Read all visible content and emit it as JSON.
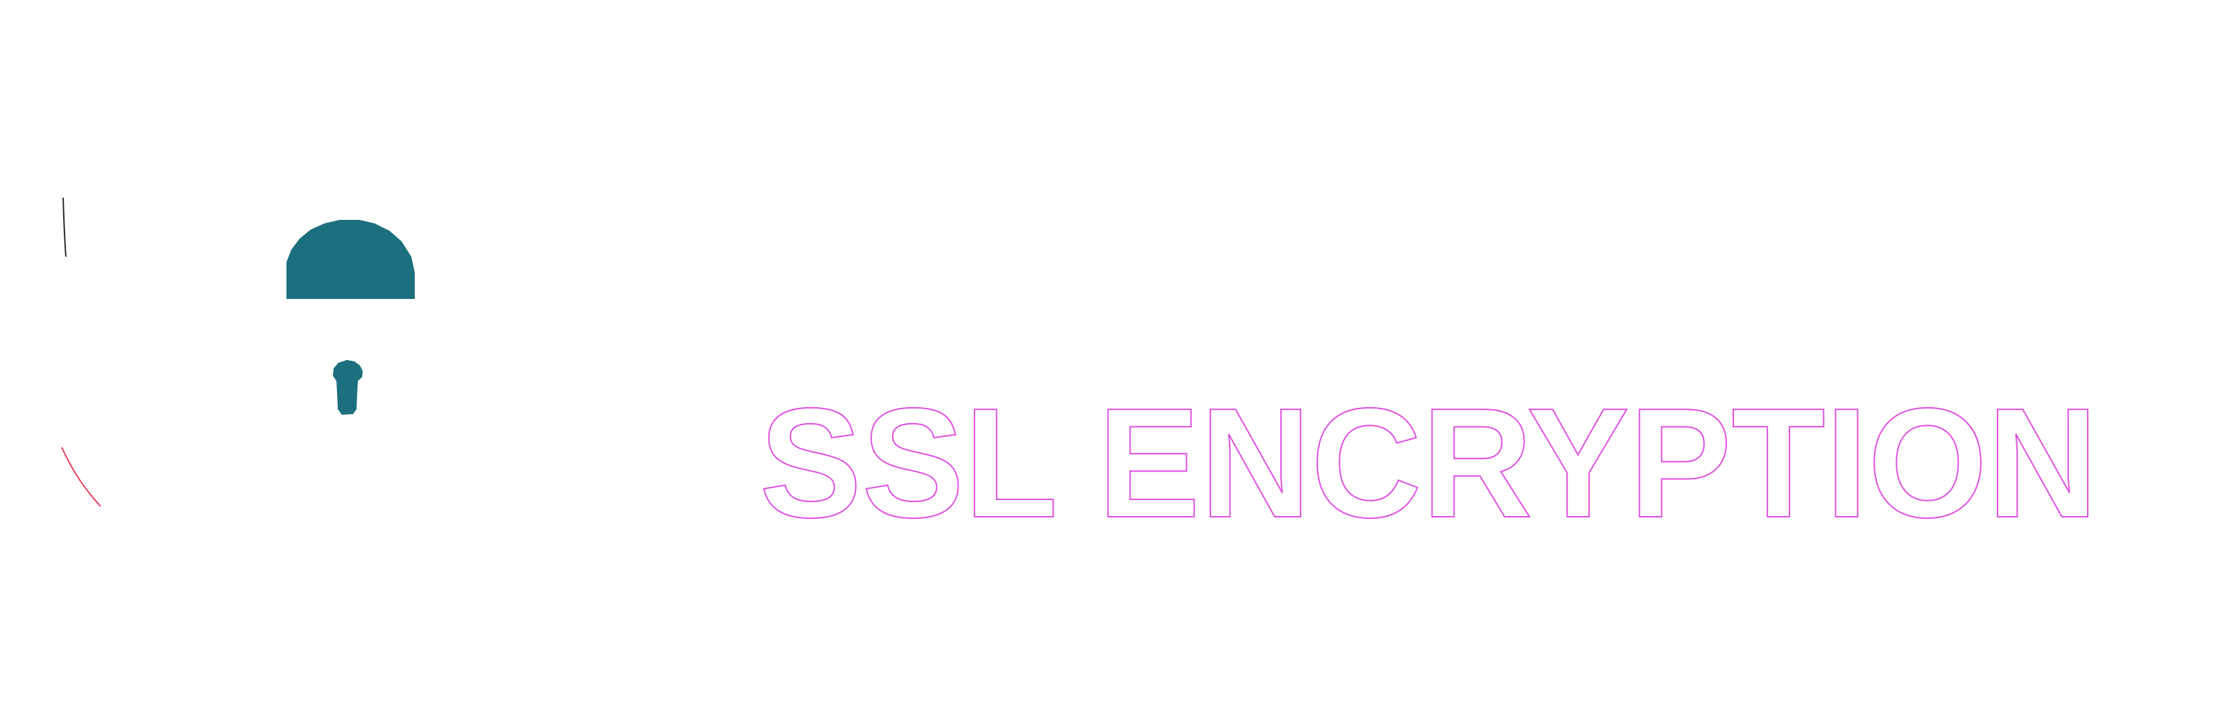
{
  "title": "SSL ENCRYPTION",
  "icon": "padlock-icon",
  "colors": {
    "background": "#ffffff",
    "lock": "#1b6f7e",
    "outline_text": "#df4fe0",
    "accent_red": "#ea3c5f",
    "dark_edge": "#2a2a2a"
  }
}
